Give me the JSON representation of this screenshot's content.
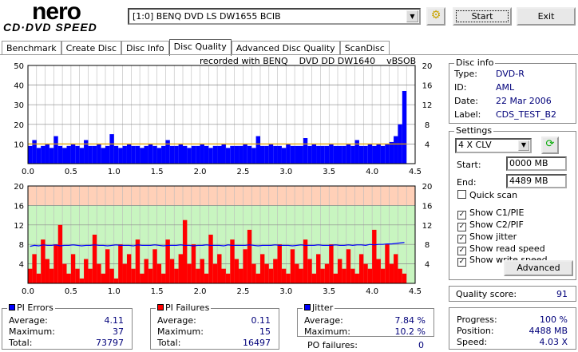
{
  "app": {
    "logo_top": "nero",
    "logo_bottom": "CD·DVD SPEED"
  },
  "toolbar": {
    "drive": "[1:0]  BENQ DVD LS DW1655 BCIB",
    "start": "Start",
    "exit": "Exit"
  },
  "tabs": [
    "Benchmark",
    "Create Disc",
    "Disc Info",
    "Disc Quality",
    "Advanced Disc Quality",
    "ScanDisc"
  ],
  "chart_header": "recorded with BENQ    DVD DD DW1640    vBSOB",
  "disc_info": {
    "title": "Disc info",
    "rows": [
      {
        "label": "Type:",
        "value": "DVD-R"
      },
      {
        "label": "ID:",
        "value": "AML"
      },
      {
        "label": "Date:",
        "value": "22 Mar 2006"
      },
      {
        "label": "Label:",
        "value": "CDS_TEST_B2"
      }
    ]
  },
  "settings": {
    "title": "Settings",
    "speed": "4 X CLV",
    "start_label": "Start:",
    "start": "0000 MB",
    "end_label": "End:",
    "end": "4489 MB",
    "checks": [
      {
        "label": "Quick scan",
        "checked": false
      },
      {
        "label": "Show C1/PIE",
        "checked": true
      },
      {
        "label": "Show C2/PIF",
        "checked": true
      },
      {
        "label": "Show jitter",
        "checked": true
      },
      {
        "label": "Show read speed",
        "checked": true
      },
      {
        "label": "Show write speed",
        "checked": true
      }
    ],
    "advanced": "Advanced"
  },
  "quality": {
    "label": "Quality score:",
    "value": "91"
  },
  "progress": {
    "rows": [
      {
        "label": "Progress:",
        "value": "100 %"
      },
      {
        "label": "Position:",
        "value": "4488 MB"
      },
      {
        "label": "Speed:",
        "value": "4.03 X"
      }
    ]
  },
  "pi_errors": {
    "title": "PI Errors",
    "color": "#0000ff",
    "rows": [
      {
        "label": "Average:",
        "value": "4.11"
      },
      {
        "label": "Maximum:",
        "value": "37"
      },
      {
        "label": "Total:",
        "value": "73797"
      }
    ]
  },
  "pi_failures": {
    "title": "PI Failures",
    "color": "#ff0000",
    "rows": [
      {
        "label": "Average:",
        "value": "0.11"
      },
      {
        "label": "Maximum:",
        "value": "15"
      },
      {
        "label": "Total:",
        "value": "16497"
      }
    ]
  },
  "jitter": {
    "title": "Jitter",
    "color": "#0000ff",
    "rows": [
      {
        "label": "Average:",
        "value": "7.84 %"
      },
      {
        "label": "Maximum:",
        "value": "10.2 %"
      }
    ],
    "po_label": "PO failures:",
    "po_value": "0"
  },
  "chart_data": [
    {
      "type": "bar",
      "title": "PI Errors",
      "xlim": [
        0,
        4.5
      ],
      "ylim": [
        0,
        50
      ],
      "y2lim": [
        0,
        20
      ],
      "xticks": [
        "0.0",
        "0.5",
        "1.0",
        "1.5",
        "2.0",
        "2.5",
        "3.0",
        "3.5",
        "4.0",
        "4.5"
      ],
      "yticks": [
        "10",
        "20",
        "30",
        "40",
        "50"
      ],
      "y2ticks": [
        "4",
        "8",
        "12",
        "16",
        "20"
      ],
      "x_step": 0.05,
      "pie": [
        9,
        12,
        8,
        9,
        10,
        8,
        14,
        9,
        8,
        9,
        10,
        9,
        8,
        12,
        9,
        9,
        10,
        8,
        9,
        15,
        9,
        8,
        9,
        10,
        9,
        9,
        8,
        9,
        10,
        9,
        8,
        9,
        12,
        9,
        9,
        10,
        9,
        8,
        9,
        9,
        10,
        9,
        8,
        9,
        9,
        10,
        8,
        9,
        9,
        9,
        10,
        9,
        8,
        14,
        9,
        9,
        10,
        9,
        9,
        8,
        10,
        9,
        9,
        9,
        13,
        9,
        10,
        9,
        9,
        9,
        10,
        9,
        9,
        9,
        10,
        9,
        12,
        9,
        9,
        10,
        9,
        10,
        9,
        10,
        11,
        14,
        20,
        37
      ],
      "read_speed": 4.0
    },
    {
      "type": "bar",
      "title": "PI Failures / Jitter",
      "xlim": [
        0,
        4.5
      ],
      "ylim": [
        0,
        20
      ],
      "y2lim": [
        0,
        20
      ],
      "xticks": [
        "0.0",
        "0.5",
        "1.0",
        "1.5",
        "2.0",
        "2.5",
        "3.0",
        "3.5",
        "4.0",
        "4.5"
      ],
      "yticks": [
        "4",
        "8",
        "12",
        "16",
        "20"
      ],
      "y2ticks": [
        "4",
        "8",
        "12",
        "16",
        "20"
      ],
      "x_step": 0.05,
      "pif": [
        3,
        6,
        2,
        9,
        5,
        3,
        8,
        12,
        4,
        2,
        6,
        3,
        1,
        5,
        3,
        10,
        4,
        2,
        7,
        3,
        1,
        8,
        4,
        6,
        3,
        9,
        2,
        5,
        3,
        7,
        4,
        2,
        9,
        5,
        3,
        6,
        13,
        4,
        8,
        3,
        5,
        2,
        10,
        4,
        6,
        3,
        2,
        9,
        5,
        3,
        7,
        11,
        4,
        2,
        6,
        4,
        3,
        5,
        8,
        3,
        2,
        7,
        4,
        3,
        9,
        5,
        2,
        6,
        3,
        4,
        8,
        2,
        5,
        3,
        7,
        3,
        2,
        6,
        4,
        3,
        11,
        5,
        3,
        8,
        4,
        6,
        3,
        2
      ],
      "jitter": [
        7.6,
        7.8,
        7.7,
        7.9,
        7.8,
        7.8,
        7.9,
        7.7,
        7.8,
        7.8,
        7.9,
        7.8,
        7.7,
        7.8,
        7.8,
        7.9,
        7.8,
        7.8,
        7.7,
        7.8,
        7.9,
        7.8,
        7.8,
        7.8,
        7.7,
        7.9,
        7.8,
        7.8,
        7.8,
        7.9,
        7.8,
        7.7,
        7.8,
        7.8,
        7.8,
        7.9,
        7.8,
        7.8,
        7.7,
        7.8,
        7.8,
        7.9,
        7.8,
        7.8,
        7.8,
        7.7,
        7.9,
        7.8,
        7.8,
        7.8,
        7.8,
        7.9,
        7.8,
        7.7,
        7.8,
        7.8,
        7.8,
        7.9,
        7.8,
        7.8,
        7.8,
        7.7,
        7.8,
        7.9,
        7.8,
        7.8,
        7.8,
        7.9,
        7.8,
        7.8,
        7.8,
        7.9,
        7.8,
        7.8,
        7.9,
        7.8,
        7.9,
        7.9,
        7.8,
        8.0,
        7.9,
        8.0,
        8.0,
        8.1,
        8.1,
        8.2,
        8.3,
        8.4
      ]
    }
  ]
}
